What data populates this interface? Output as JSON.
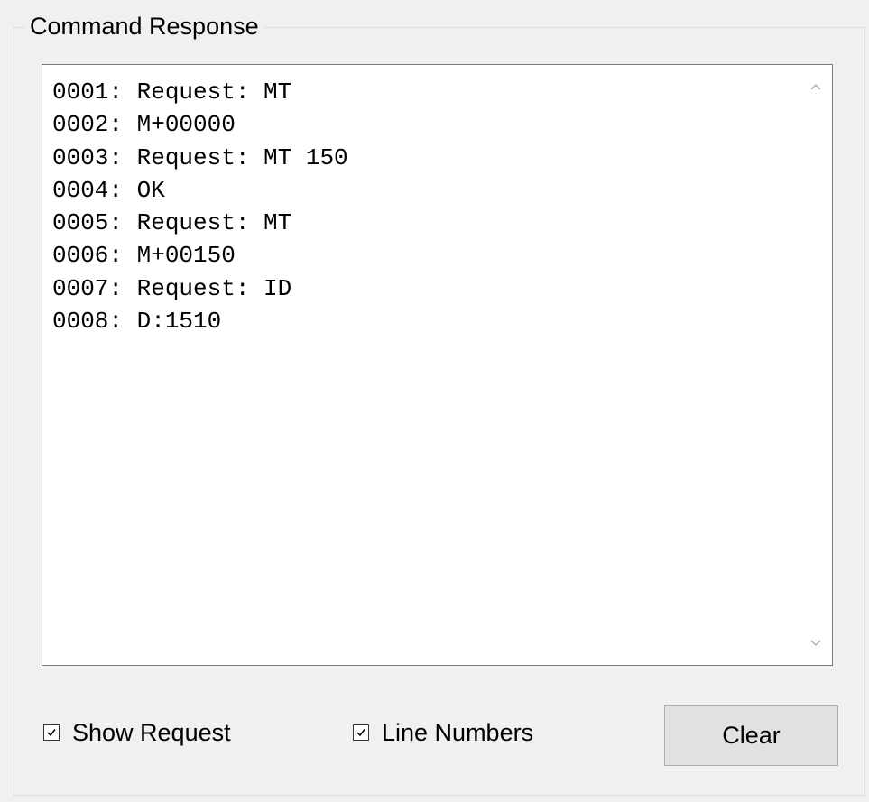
{
  "group": {
    "title": "Command Response"
  },
  "response": {
    "lines": [
      "0001: Request: MT",
      "0002: M+00000",
      "0003: Request: MT 150",
      "0004: OK",
      "0005: Request: MT",
      "0006: M+00150",
      "0007: Request: ID",
      "0008: D:1510"
    ]
  },
  "options": {
    "show_request": {
      "label": "Show Request",
      "checked": true
    },
    "line_numbers": {
      "label": "Line Numbers",
      "checked": true
    }
  },
  "actions": {
    "clear_label": "Clear"
  },
  "icons": {
    "scroll_up": "chevron-up-icon",
    "scroll_down": "chevron-down-icon",
    "check": "checkmark-icon"
  }
}
